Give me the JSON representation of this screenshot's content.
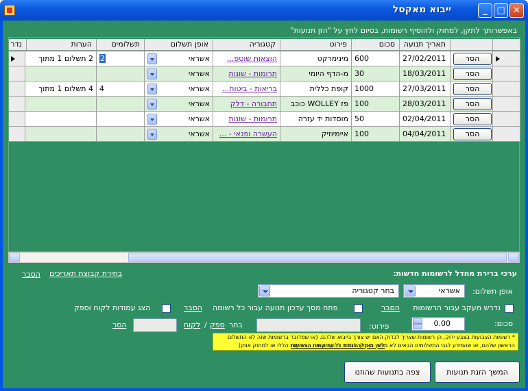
{
  "window": {
    "title": "ייבוא מאקסל"
  },
  "hint": "באפשרותך לתקן, למחוק ולהוסיף רשומות, בסיום לחץ על \"הזן תנועות\"",
  "grid": {
    "columns": [
      "תאריך תנועה",
      "סכום",
      "פירוט",
      "קטגוריה",
      "אופן תשלום",
      "תשלומים",
      "הערות",
      "נדר"
    ],
    "remove_label": "הסר",
    "rows": [
      {
        "date": "27/02/2011",
        "amount": "600",
        "detail": "מינימרקט",
        "category": "הוצאות שוטפ...",
        "payment": "אשראי",
        "installments": "2",
        "notes": "2 תשלום 1 מתוך",
        "selected": true
      },
      {
        "date": "18/03/2011",
        "amount": "30",
        "detail": "מ-הדף היומי",
        "category": "תרומות - שונות",
        "payment": "אשראי",
        "installments": "",
        "notes": "",
        "selected": false
      },
      {
        "date": "27/03/2011",
        "amount": "1000",
        "detail": "קופת כללית",
        "category": "בריאות - ביטוח...",
        "payment": "אשראי",
        "installments": "4",
        "notes": "4 תשלום 1 מתוך",
        "selected": false
      },
      {
        "date": "28/03/2011",
        "amount": "100",
        "detail": "פז WOLLEY כוכב",
        "category": "תחבורה - דלק",
        "payment": "אשראי",
        "installments": "",
        "notes": "",
        "selected": false
      },
      {
        "date": "02/04/2011",
        "amount": "50",
        "detail": "מוסדות יד עזרה",
        "category": "תרומות - שונות",
        "payment": "אשראי",
        "installments": "",
        "notes": "",
        "selected": false
      },
      {
        "date": "04/04/2011",
        "amount": "100",
        "detail": "איימיוזיק",
        "category": "העשרה ופנאי - ...",
        "payment": "אשראי",
        "installments": "",
        "notes": "",
        "selected": false
      }
    ]
  },
  "defaults": {
    "heading": "ערכי ברירת מחדל לרשומות חדשות:",
    "explain": "הסבר",
    "date_range_link": "בחירת קבוצת תאריכים",
    "payment_label": "אופן תשלום:",
    "payment_value": "אשראי",
    "category_value": "בחר קטגוריה",
    "tracking_label": "נדרש מעקב עבור הרשומות",
    "open_screen_label": "פתח מסך עדכון תנועה עבור כל רשומה",
    "show_columns_label": "הצג עמודות לקוח וספק",
    "amount_label": "סכום:",
    "amount_value": "0.00",
    "detail_label": "פירוט:",
    "choose_label": "בחר",
    "supplier_link": "ספק",
    "customer_link": "לקוח",
    "remove_link": "הסר",
    "note_line1": "* רשומות הצבועות בצבע ירוק, הן רשומות שצריך לבדוק האם יש צורך בייבוא שלהם. (או שמדובר ברשומות שזה לא התשלום",
    "note_line2": "הראשון שלהם, או שהמידע לגבי התשלומים הבאים לא מלא. מומלץ לבחור להעתיק את הרשומות הללו או למחוק אותן)",
    "note_link": "לחץ כאן להסתרת כל הרשומות הצבועות"
  },
  "buttons": {
    "continue": "המשך הזנת תנועות",
    "view_entered": "צפה בתנועות שהוזנו"
  }
}
